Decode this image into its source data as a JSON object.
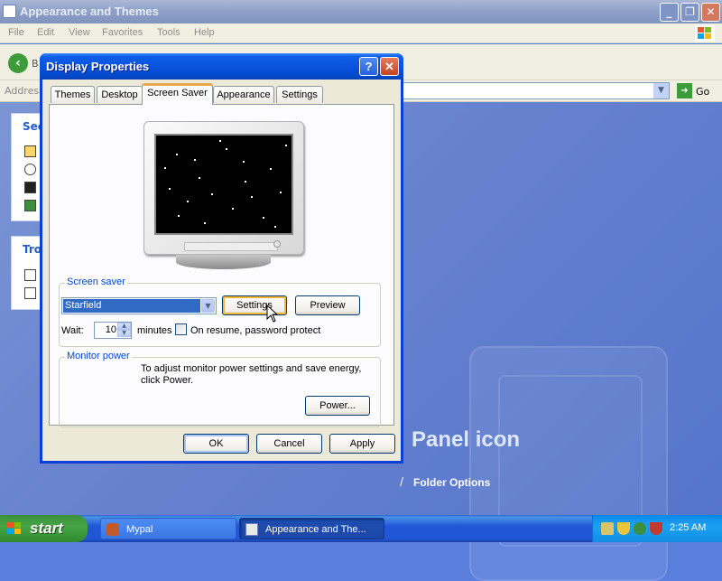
{
  "background_window": {
    "title": "Appearance and Themes",
    "menu": [
      "File",
      "Edit",
      "View",
      "Favorites",
      "Tools",
      "Help"
    ],
    "back_label": "B",
    "address_label": "Address",
    "go_label": "Go",
    "see_also_header": "See",
    "troubleshooters_header": "Tro",
    "panel_icon_text": "Panel icon",
    "folder_options_label": "Folder Options"
  },
  "dialog": {
    "title": "Display Properties",
    "help_label": "?",
    "close_label": "✕",
    "tabs": [
      "Themes",
      "Desktop",
      "Screen Saver",
      "Appearance",
      "Settings"
    ],
    "active_tab": "Screen Saver",
    "screen_saver": {
      "group_label": "Screen saver",
      "selected": "Starfield",
      "settings_button": "Settings",
      "preview_button": "Preview",
      "wait_label": "Wait:",
      "wait_value": "10",
      "minutes_label": "minutes",
      "password_checkbox_label": "On resume, password protect",
      "password_checked": false
    },
    "monitor_power": {
      "group_label": "Monitor power",
      "description": "To adjust monitor power settings and save energy, click Power.",
      "power_button": "Power..."
    },
    "buttons": {
      "ok": "OK",
      "cancel": "Cancel",
      "apply": "Apply"
    }
  },
  "taskbar": {
    "start_label": "start",
    "items": [
      {
        "label": "Mypal"
      },
      {
        "label": "Appearance and The..."
      }
    ],
    "clock": "2:25 AM"
  },
  "colors": {
    "xp_blue_title": "#0a53df",
    "selection_blue": "#316ac5",
    "group_label_blue": "#0046d5",
    "dialog_face": "#ece9d8",
    "taskbar_blue": "#2157d7",
    "start_green": "#46a546"
  }
}
